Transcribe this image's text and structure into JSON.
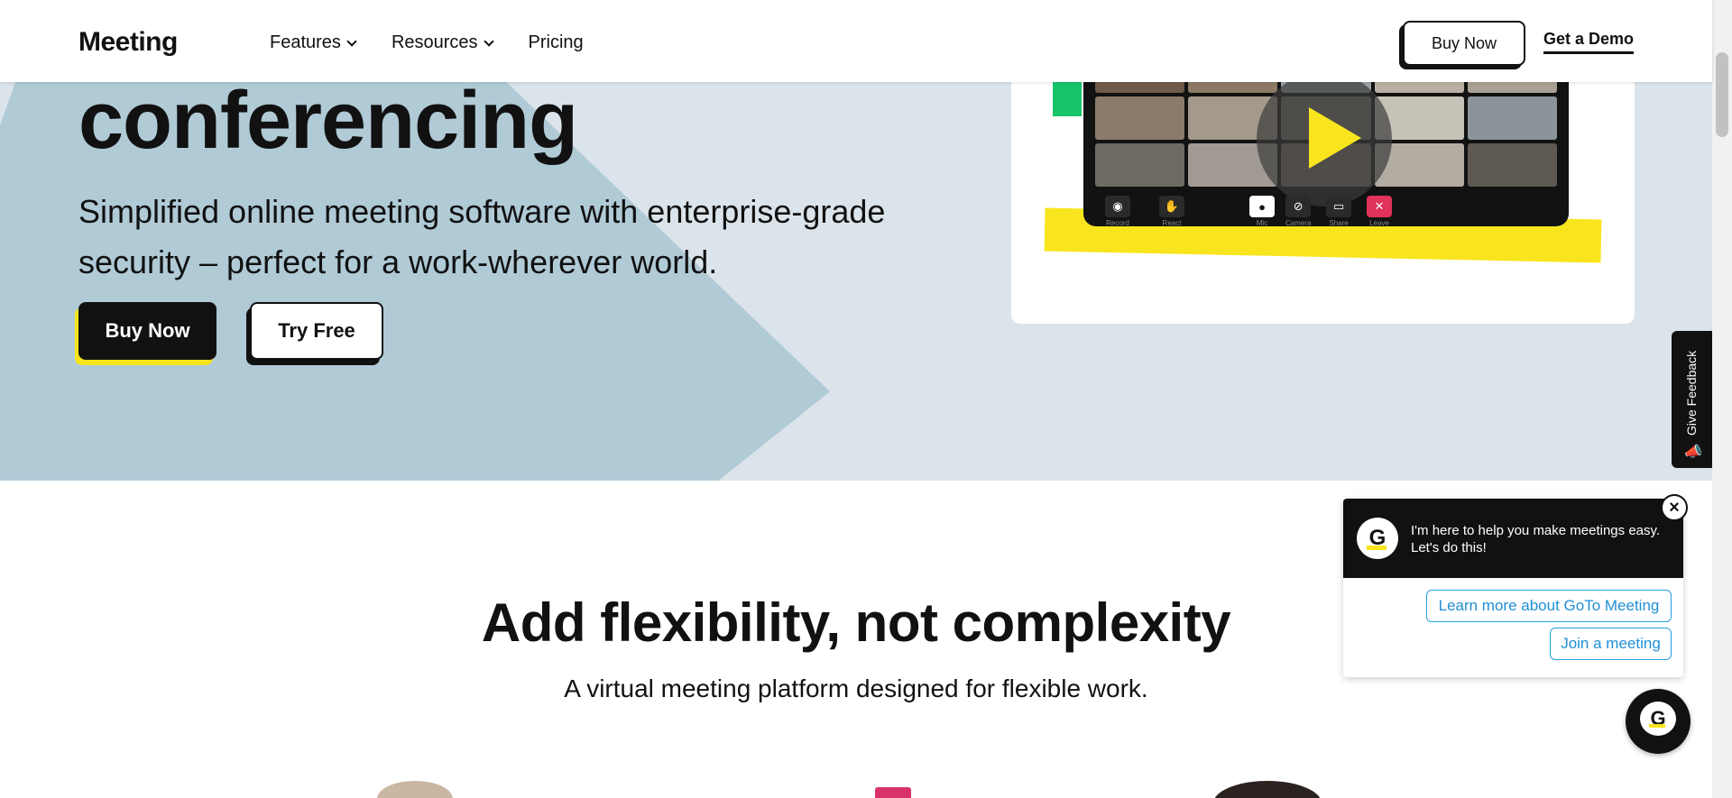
{
  "header": {
    "logo": "Meeting",
    "nav": [
      {
        "label": "Features",
        "dropdown": true
      },
      {
        "label": "Resources",
        "dropdown": true
      },
      {
        "label": "Pricing",
        "dropdown": false
      }
    ],
    "buy_now_label": "Buy Now",
    "get_demo_label": "Get a Demo"
  },
  "hero": {
    "title": "conferencing",
    "subtitle": "Simplified online meeting software with enterprise-grade security – perfect for a work-wherever world.",
    "buy_now_label": "Buy Now",
    "try_free_label": "Try Free",
    "video": {
      "play_icon": "play-icon",
      "controls": [
        "Record",
        "React",
        "Mic",
        "Camera",
        "Share",
        "Leave"
      ]
    }
  },
  "feedback_tab": {
    "label": "Give Feedback",
    "icon": "megaphone-icon"
  },
  "section": {
    "title": "Add flexibility, not complexity",
    "subtitle": "A virtual meeting platform designed for flexible work."
  },
  "chat": {
    "avatar_letter": "G",
    "message": "I'm here to help you make meetings easy. Let's do this!",
    "options": [
      "Learn more about GoTo Meeting",
      "Join a meeting"
    ],
    "close_icon": "close-icon"
  },
  "colors": {
    "accent_yellow": "#f8e51e",
    "accent_green": "#17c46a",
    "hero_bg": "#dbe4ea",
    "hero_shape": "#b0cad6",
    "link_blue": "#1f8fd6",
    "leave_red": "#e0325a"
  }
}
